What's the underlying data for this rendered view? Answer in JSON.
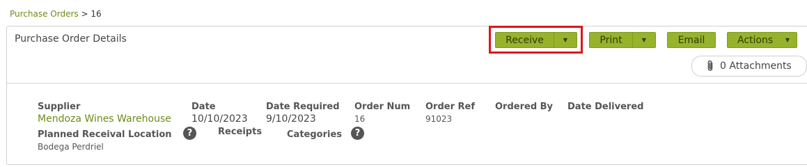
{
  "breadcrumb": {
    "parent": "Purchase Orders",
    "separator": " > ",
    "current": "16"
  },
  "panel": {
    "title": "Purchase Order Details"
  },
  "toolbar": {
    "receive_label": "Receive",
    "print_label": "Print",
    "email_label": "Email",
    "actions_label": "Actions",
    "caret": "▼",
    "attachments_label": "0 Attachments"
  },
  "details": {
    "supplier_label": "Supplier",
    "supplier_value": "Mendoza Wines Warehouse",
    "date_label": "Date",
    "date_value": "10/10/2023",
    "date_required_label": "Date Required",
    "date_required_value": "9/10/2023",
    "order_num_label": "Order Num",
    "order_num_value": "16",
    "order_ref_label": "Order Ref",
    "order_ref_value": "91023",
    "ordered_by_label": "Ordered By",
    "date_delivered_label": "Date Delivered",
    "planned_location_label": "Planned Receival Location",
    "planned_location_value": "Bodega Perdriel",
    "receipts_label": "Receipts",
    "categories_label": "Categories",
    "help_glyph": "?"
  },
  "colors": {
    "accent": "#97b32c",
    "link": "#6e8a16",
    "highlight": "#e0141c"
  }
}
